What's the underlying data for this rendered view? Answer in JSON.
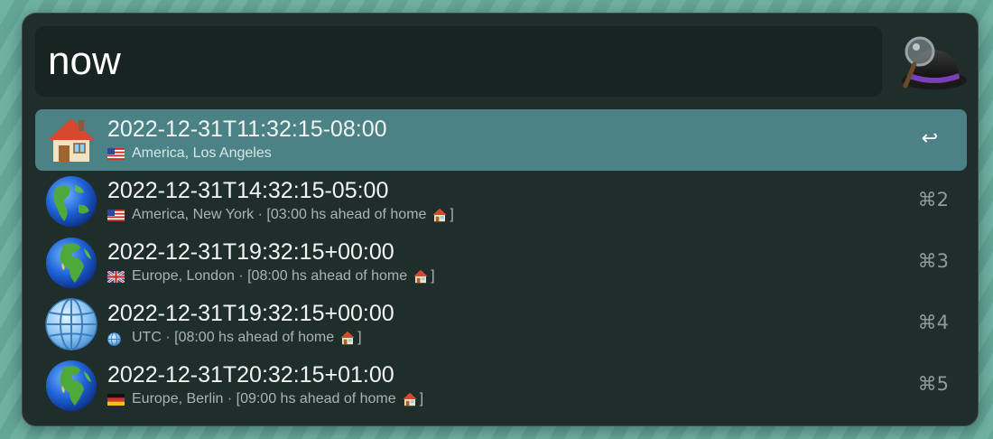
{
  "search": {
    "query": "now"
  },
  "results": [
    {
      "title": "2022-12-31T11:32:15-08:00",
      "location": "America, Los Angeles",
      "note": "",
      "icon": "house-icon",
      "flag": "us-flag-icon",
      "shortcut": "↩",
      "selected": true
    },
    {
      "title": "2022-12-31T14:32:15-05:00",
      "location": "America, New York",
      "note": "· [03:00 hs ahead of home",
      "note_end": "]",
      "icon": "globe-americas-icon",
      "flag": "us-flag-icon",
      "shortcut": "⌘2",
      "selected": false
    },
    {
      "title": "2022-12-31T19:32:15+00:00",
      "location": "Europe, London",
      "note": "· [08:00 hs ahead of home",
      "note_end": "]",
      "icon": "globe-europe-africa-icon",
      "flag": "uk-flag-icon",
      "shortcut": "⌘3",
      "selected": false
    },
    {
      "title": "2022-12-31T19:32:15+00:00",
      "location": "UTC",
      "note": "· [08:00 hs ahead of home",
      "note_end": "]",
      "icon": "globe-meridians-icon",
      "flag": "globe-meridians-icon",
      "shortcut": "⌘4",
      "selected": false
    },
    {
      "title": "2022-12-31T20:32:15+01:00",
      "location": "Europe, Berlin",
      "note": "· [09:00 hs ahead of home",
      "note_end": "]",
      "icon": "globe-europe-africa-icon",
      "flag": "germany-flag-icon",
      "shortcut": "⌘5",
      "selected": false
    }
  ],
  "colors": {
    "window_bg": "#1f2d2b",
    "selected_row": "#4a8285",
    "search_bg": "#182422"
  }
}
